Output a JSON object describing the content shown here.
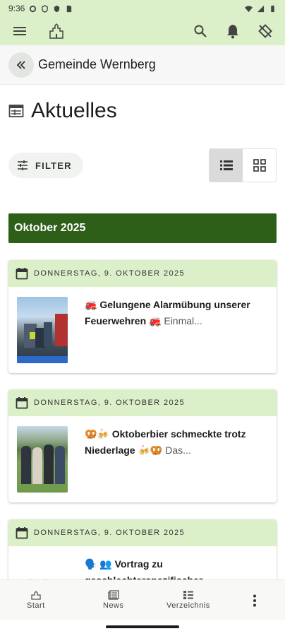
{
  "status_bar": {
    "time": "9:36"
  },
  "app_bar": {
    "icons": [
      "menu-icon",
      "municipality-icon",
      "search-icon",
      "bell-icon",
      "rotate-icon"
    ],
    "accent": "#dbefc9"
  },
  "breadcrumb": {
    "title": "Gemeinde Wernberg"
  },
  "page": {
    "title": "Aktuelles"
  },
  "filter": {
    "label": "FILTER"
  },
  "view_toggle": {
    "active": "list"
  },
  "month": {
    "label": "Oktober 2025",
    "color": "#2e5f19"
  },
  "news": [
    {
      "date": "DONNERSTAG, 9. OKTOBER 2025",
      "title": "🚒 Gelungene Alarmübung unserer Feuerwehren 🚒",
      "excerpt": " Einmal..."
    },
    {
      "date": "DONNERSTAG, 9. OKTOBER 2025",
      "title": "🥨🍻 Oktoberbier schmeckte trotz Niederlage 🍻🥨",
      "excerpt": " Das..."
    },
    {
      "date": "DONNERSTAG, 9. OKTOBER 2025",
      "title": "🗣️ 👥 Vortrag zu geschlechterspezifischer",
      "excerpt": ""
    }
  ],
  "bottom_nav": {
    "start": "Start",
    "news": "News",
    "directory": "Verzeichnis"
  }
}
